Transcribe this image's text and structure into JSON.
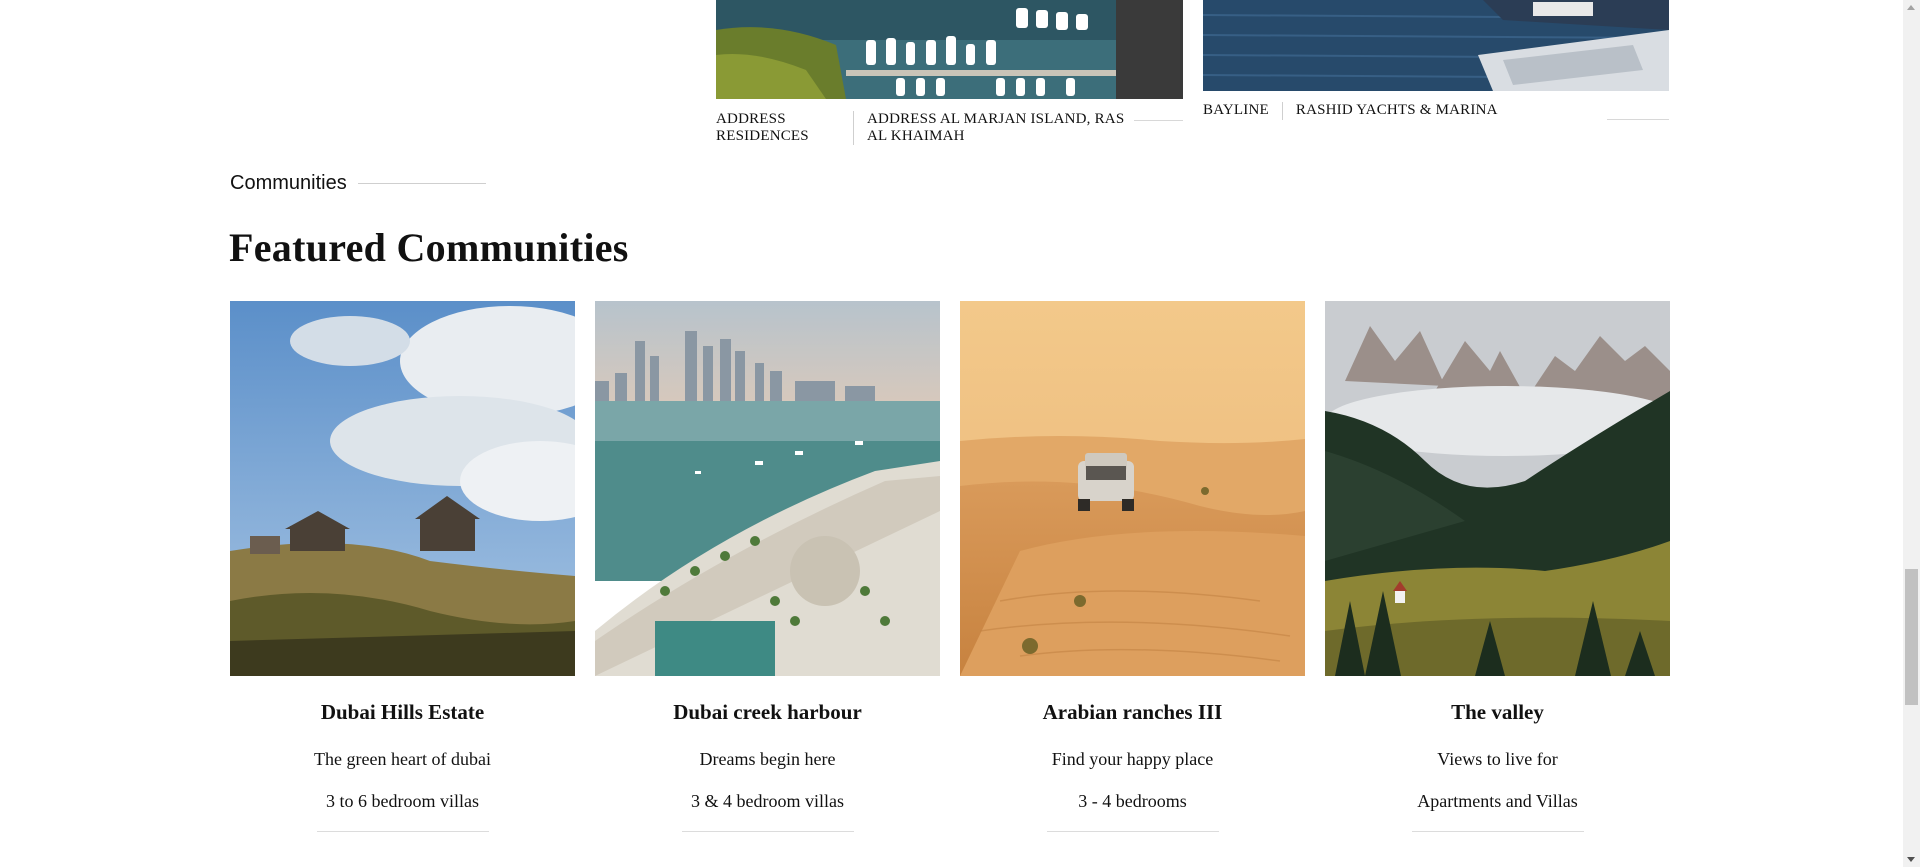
{
  "properties": [
    {
      "name": "ADDRESS RESIDENCES",
      "location": "ADDRESS AL MARJAN ISLAND, RAS AL KHAIMAH",
      "image": "marina-harbour-photo"
    },
    {
      "name": "BAYLINE",
      "location": "RASHID YACHTS & MARINA",
      "image": "yacht-marina-photo"
    }
  ],
  "section": {
    "label": "Communities",
    "title": "Featured Communities"
  },
  "communities": [
    {
      "name": "Dubai Hills Estate",
      "tagline": "The green heart of dubai",
      "detail": "3 to 6 bedroom villas",
      "image": "hillside-houses-photo"
    },
    {
      "name": "Dubai creek harbour",
      "tagline": "Dreams begin here",
      "detail": "3 & 4 bedroom villas",
      "image": "dubai-marina-aerial-photo"
    },
    {
      "name": "Arabian ranches III",
      "tagline": "Find your happy place",
      "detail": "3 - 4 bedrooms",
      "image": "desert-suv-photo"
    },
    {
      "name": "The valley",
      "tagline": "Views to live for",
      "detail": "Apartments and Villas",
      "image": "mountain-valley-photo"
    }
  ],
  "colors": {
    "text": "#111111",
    "divider": "#cfcfcf",
    "scrollbar_track": "#f1f1f1",
    "scrollbar_thumb": "#c1c1c1"
  }
}
